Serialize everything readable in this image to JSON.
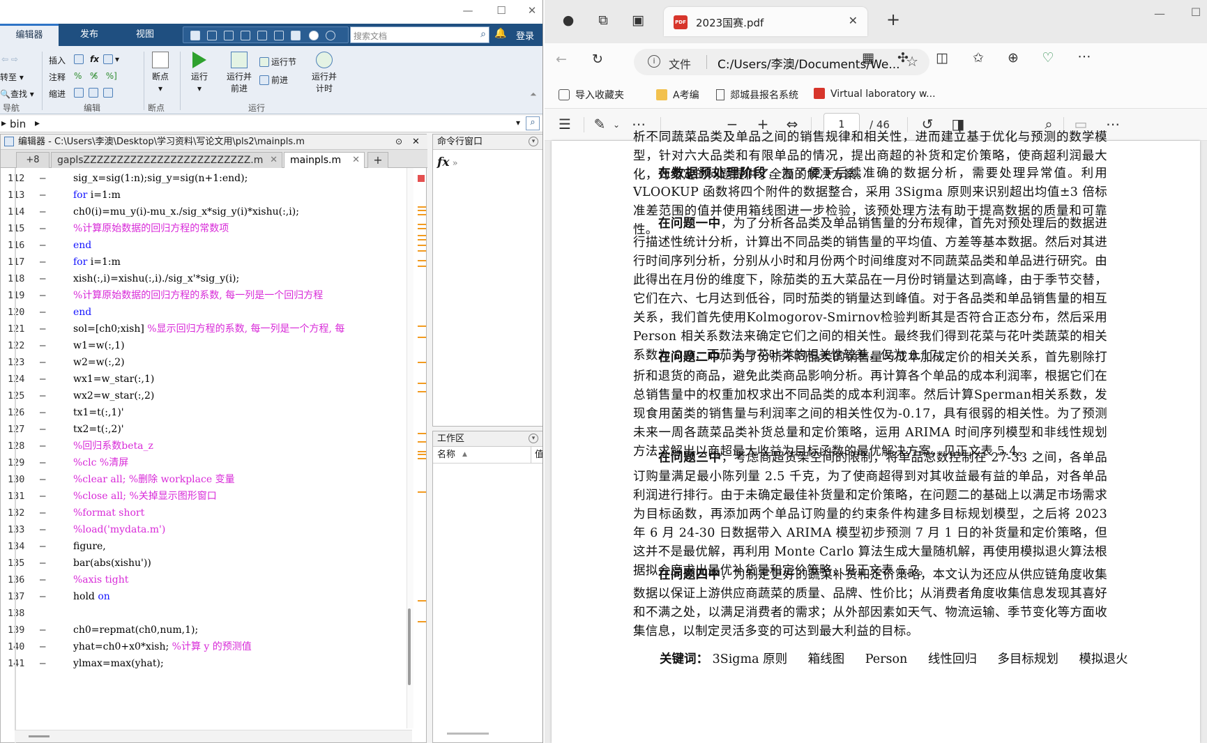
{
  "matlab": {
    "tabs": [
      "编辑器",
      "发布",
      "视图"
    ],
    "search_placeholder": "搜索文档",
    "login": "登录",
    "ribbon": {
      "nav": [
        "转至",
        "查找"
      ],
      "nav_group": "导航",
      "edit_items": [
        "插入",
        "注释",
        "缩进"
      ],
      "edit_group": "编辑",
      "breakpoint": "断点",
      "breakpoint_group": "断点",
      "run": "运行",
      "run_advance": "运行并前进",
      "run_section": "运行节",
      "advance": "前进",
      "run_time": "运行并计时",
      "run_group": "运行"
    },
    "path": "bin",
    "editor_title": "编辑器 - C:\\Users\\李澳\\Desktop\\学习资料\\写论文用\\pls2\\mainpls.m",
    "tab_more": "+8",
    "editor_tabs": [
      "gaplsZZZZZZZZZZZZZZZZZZZZZZZZZ.m",
      "mainpls.m"
    ],
    "code_lines": [
      {
        "n": "112",
        "t": "sig_x=sig(1:n);sig_y=sig(n+1:end);",
        "c": false
      },
      {
        "n": "113",
        "t": "for i=1:m",
        "c": false
      },
      {
        "n": "114",
        "t": "ch0(i)=mu_y(i)-mu_x./sig_x*sig_y(i)*xishu(:,i);",
        "c": false
      },
      {
        "n": "115",
        "t": "%计算原始数据的回归方程的常数项",
        "c": true
      },
      {
        "n": "116",
        "t": "end",
        "c": false
      },
      {
        "n": "117",
        "t": "for i=1:m",
        "c": false
      },
      {
        "n": "118",
        "t": "xish(:,i)=xishu(:,i)./sig_x'*sig_y(i);",
        "c": false
      },
      {
        "n": "119",
        "t": "%计算原始数据的回归方程的系数, 每一列是一个回归方程",
        "c": true
      },
      {
        "n": "120",
        "t": "end",
        "c": false
      },
      {
        "n": "121",
        "t": "sol=[ch0;xish] %显示回归方程的系数, 每一列是一个方程, 每",
        "c": false
      },
      {
        "n": "122",
        "t": "w1=w(:,1)",
        "c": false
      },
      {
        "n": "123",
        "t": "w2=w(:,2)",
        "c": false
      },
      {
        "n": "124",
        "t": "wx1=w_star(:,1)",
        "c": false
      },
      {
        "n": "125",
        "t": "wx2=w_star(:,2)",
        "c": false
      },
      {
        "n": "126",
        "t": "tx1=t(:,1)'",
        "c": false
      },
      {
        "n": "127",
        "t": "tx2=t(:,2)'",
        "c": false
      },
      {
        "n": "128",
        "t": "%回归系数beta_z",
        "c": true
      },
      {
        "n": "129",
        "t": "%clc %清屏",
        "c": true
      },
      {
        "n": "130",
        "t": "%clear all; %删除 workplace 变量",
        "c": true
      },
      {
        "n": "131",
        "t": "%close all; %关掉显示图形窗口",
        "c": true
      },
      {
        "n": "132",
        "t": "%format short",
        "c": true
      },
      {
        "n": "133",
        "t": "%load('mydata.m')",
        "c": true
      },
      {
        "n": "134",
        "t": "figure,",
        "c": false
      },
      {
        "n": "135",
        "t": "bar(abs(xishu'))",
        "c": false
      },
      {
        "n": "136",
        "t": "%axis tight",
        "c": true
      },
      {
        "n": "137",
        "t": "hold on",
        "c": false
      },
      {
        "n": "138",
        "t": "",
        "c": false
      },
      {
        "n": "139",
        "t": "ch0=repmat(ch0,num,1);",
        "c": false
      },
      {
        "n": "140",
        "t": "yhat=ch0+x0*xish; %计算 y 的预测值",
        "c": false
      },
      {
        "n": "141",
        "t": "ylmax=max(yhat);",
        "c": false
      }
    ],
    "cmd_title": "命令行窗口",
    "fx": "fx",
    "ws_title": "工作区",
    "ws_col1": "名称",
    "ws_col2": "值"
  },
  "edge": {
    "tab_title": "2023国赛.pdf",
    "address_label": "文件",
    "address_url": "C:/Users/李澳/Documents/We...",
    "favorites": [
      "导入收藏夹",
      "A考编",
      "郯城县报名系统",
      "Virtual laboratory w..."
    ],
    "page_current": "1",
    "page_total": "/ 46",
    "doc": {
      "line0": "析不同蔬菜品类及单品之间的销售规律和相关性，进而建立基于优化与预测的数学模型，针对六大品类和有限单品的情况，提出商超的补货和定价策略，使商超利润最大化，为给定的问题提供了全面的解决方案。",
      "p1_bold": "在数据预处理阶段",
      "p1": "，为了便于后续准确的数据分析，需要处理异常值。利用VLOOKUP 函数将四个附件的数据整合，采用 3Sigma 原则来识别超出均值±3 倍标准差范围的值并使用箱线图进一步检验，该预处理方法有助于提高数据的质量和可靠性。",
      "p2_bold": "在问题一中",
      "p2": "，为了分析各品类及单品销售量的分布规律，首先对预处理后的数据进行描述性统计分析，计算出不同品类的销售量的平均值、方差等基本数据。然后对其进行时间序列分析，分别从小时和月份两个时间维度对不同蔬菜品类和单品进行研究。由此得出在月份的维度下，除茄类的五大菜品在一月份时销量达到高峰，由于季节交替，它们在六、七月达到低谷，同时茄类的销量达到峰值。对于各品类和单品销售量的相互关系，我们首先使用Kolmogorov-Smirnov检验判断其是否符合正态分布，然后采用 Person 相关系数法来确定它们之间的相关性。最终我们得到花菜与花叶类蔬菜的相关系数为 0.9，而茄类与花叶类的相关性较差，仅为 0.17。",
      "p3_bold": "在问题二中",
      "p3": "，为了分析不同品类的销售量与成本加成定价的相关关系，首先剔除打折和退货的商品，避免此类商品影响分析。再计算各个单品的成本利润率，根据它们在总销售量中的权重加权求出不同品类的成本利润率。然后计算Sperman相关系数，发现食用菌类的销售量与利润率之间的相关性仅为-0.17，具有很弱的相关性。为了预测未来一周各蔬菜品类补货总量和定价策略，运用 ARIMA 时间序列模型和非线性规划方法求解出以商超最大收益为目标函数的最优解决方案，见正文表 5.4。",
      "p4_bold": "在问题三中",
      "p4": "，考虑商超货架空间的限制，将单品总数控制在 27-33 之间，各单品订购量满足最小陈列量 2.5 千克，为了使商超得到对其收益最有益的单品，对各单品利润进行排行。由于未确定最佳补货量和定价策略，在问题二的基础上以满足市场需求为目标函数，再添加两个单品订购量的约束条件构建多目标规划模型，之后将 2023 年 6 月 24-30 日数据带入 ARIMA 模型初步预测 7 月 1 日的补货量和定价策略，但这并不是最优解，再利用 Monte Carlo 算法生成大量随机解，再使用模拟退火算法根据拟合度求出最优补货量和定价策略，见正文表 5.7。",
      "p5_bold": "在问题四中",
      "p5": "，为制定更好的蔬菜补货和定价策略，本文认为还应从供应链角度收集数据以保证上游供应商蔬菜的质量、品牌、性价比；从消费者角度收集信息发现其喜好和不满之处，以满足消费者的需求；从外部因素如天气、物流运输、季节变化等方面收集信息，以制定灵活多变的可达到最大利益的目标。",
      "kw_label": "关键词：",
      "keywords": [
        "3Sigma 原则",
        "箱线图",
        "Person",
        "线性回归",
        "多目标规划",
        "模拟退火"
      ]
    }
  },
  "colors": {
    "matlab_blue": "#1f4f80",
    "comment": "#d82ad8",
    "keyword": "#1212ff",
    "pdf_red": "#d7352b"
  }
}
